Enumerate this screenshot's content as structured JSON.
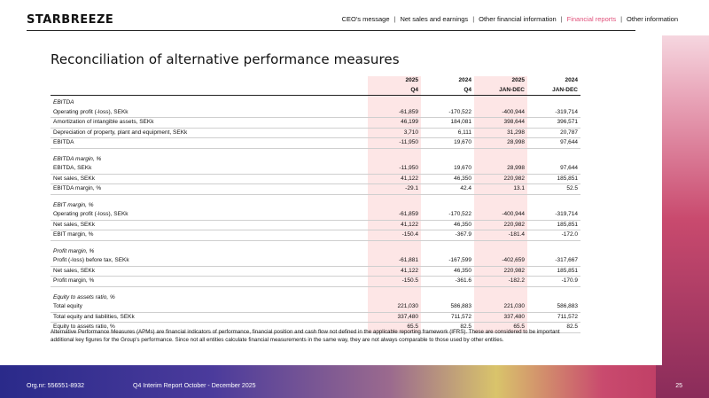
{
  "logo": "STARBREEZE",
  "nav": [
    "CEO's message",
    "Net sales and earnings",
    "Other financial information",
    "Financial reports",
    "Other information"
  ],
  "nav_active": "Financial reports",
  "title": "Reconciliation of alternative performance measures",
  "headers": {
    "years": [
      "2025",
      "2024",
      "2025",
      "2024"
    ],
    "periods": [
      "Q4",
      "Q4",
      "JAN-DEC",
      "JAN-DEC"
    ]
  },
  "sections": [
    {
      "title": "EBITDA",
      "rows": [
        {
          "label": "Operating profit (-loss), SEKk",
          "values": [
            "-61,859",
            "-170,522",
            "-400,944",
            "-319,714"
          ]
        },
        {
          "label": "Amortization of intangible assets, SEKk",
          "values": [
            "46,199",
            "184,081",
            "398,644",
            "396,571"
          ]
        },
        {
          "label": "Depreciation of property, plant and equipment, SEKk",
          "values": [
            "3,710",
            "6,111",
            "31,298",
            "20,787"
          ]
        },
        {
          "label": "EBITDA",
          "values": [
            "-11,950",
            "19,670",
            "28,998",
            "97,644"
          ]
        }
      ]
    },
    {
      "title": "EBITDA margin, %",
      "rows": [
        {
          "label": "EBITDA, SEKk",
          "values": [
            "-11,950",
            "19,670",
            "28,998",
            "97,644"
          ]
        },
        {
          "label": "Net sales, SEKk",
          "values": [
            "41,122",
            "46,350",
            "220,982",
            "185,851"
          ]
        },
        {
          "label": "EBITDA margin, %",
          "values": [
            "-29.1",
            "42.4",
            "13.1",
            "52.5"
          ]
        }
      ]
    },
    {
      "title": "EBIT margin, %",
      "rows": [
        {
          "label": "Operating profit (-loss), SEKk",
          "values": [
            "-61,859",
            "-170,522",
            "-400,944",
            "-319,714"
          ]
        },
        {
          "label": "Net sales, SEKk",
          "values": [
            "41,122",
            "46,350",
            "220,982",
            "185,851"
          ]
        },
        {
          "label": "EBIT margin, %",
          "values": [
            "-150.4",
            "-367.9",
            "-181.4",
            "-172.0"
          ]
        }
      ]
    },
    {
      "title": "Profit margin, %",
      "rows": [
        {
          "label": "Profit (-loss) before tax, SEKk",
          "values": [
            "-61,881",
            "-167,599",
            "-402,659",
            "-317,667"
          ]
        },
        {
          "label": "Net sales, SEKk",
          "values": [
            "41,122",
            "46,350",
            "220,982",
            "185,851"
          ]
        },
        {
          "label": "Profit margin, %",
          "values": [
            "-150.5",
            "-361.6",
            "-182.2",
            "-170.9"
          ]
        }
      ]
    },
    {
      "title": "Equity to assets ratio, %",
      "rows": [
        {
          "label": "Total equity",
          "values": [
            "221,030",
            "586,883",
            "221,030",
            "586,883"
          ]
        },
        {
          "label": "Total equity and liabilities, SEKk",
          "values": [
            "337,480",
            "711,572",
            "337,480",
            "711,572"
          ]
        },
        {
          "label": "Equity to assets ratio, %",
          "values": [
            "65.5",
            "82.5",
            "65.5",
            "82.5"
          ]
        }
      ]
    }
  ],
  "note": "Alternative Performance Measures (APMs) are financial indicators of performance, financial position and cash flow not defined in the applicable reporting framework (IFRS). These are considered to be important additional key figures for the Group's performance. Since not all entities calculate financial measurements in the same way, they are not always comparable to those used by other entities.",
  "footer": {
    "org": "Org.nr: 556551-8932",
    "report": "Q4 Interim Report October - December 2025",
    "page": "25"
  },
  "colors": {
    "accent": "#e0507a",
    "highlight": "#fde6e6"
  }
}
